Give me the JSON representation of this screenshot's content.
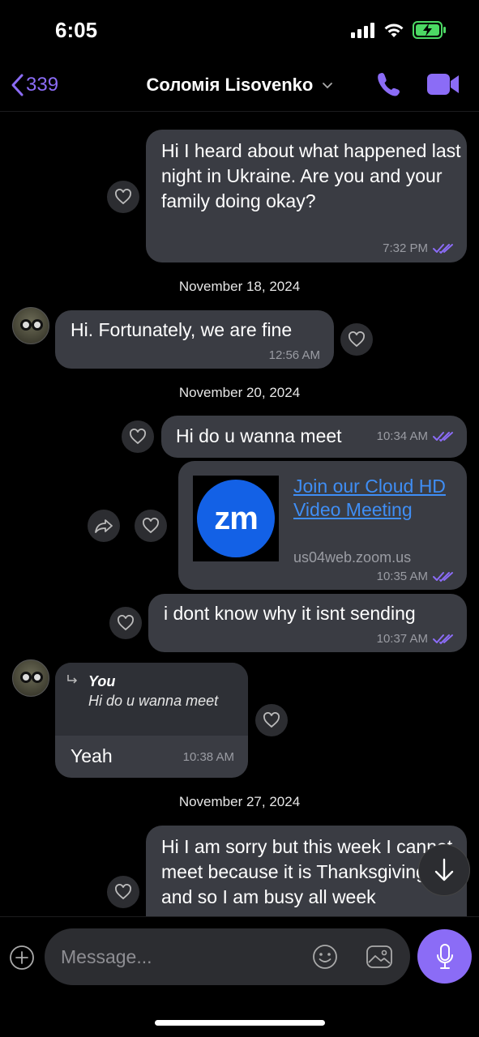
{
  "status": {
    "time": "6:05"
  },
  "header": {
    "back_count": "339",
    "contact_name": "Соломія Lisovenko"
  },
  "colors": {
    "accent": "#8b6cf6",
    "bubble": "#3a3c43",
    "link": "#3f8ef5"
  },
  "messages": {
    "m1": {
      "text": "Hi I heard about what happened last night in Ukraine. Are you and your family doing okay?",
      "time": "7:32 PM"
    },
    "date1": "November 18, 2024",
    "m2": {
      "text": "Hi. Fortunately, we are fine",
      "time": "12:56 AM"
    },
    "date2": "November 20, 2024",
    "m3": {
      "text": "Hi do u wanna meet",
      "time": "10:34 AM"
    },
    "m4": {
      "logo_text": "zm",
      "link_title": "Join our Cloud HD Video Meeting",
      "domain": "us04web.zoom.us",
      "time": "10:35 AM"
    },
    "m5": {
      "text": "i dont know why it isnt sending",
      "time": "10:37 AM"
    },
    "m6": {
      "reply_author": "You",
      "reply_text": "Hi do u wanna meet",
      "text": "Yeah",
      "time": "10:38 AM"
    },
    "date3": "November 27, 2024",
    "m7": {
      "text": "Hi I am sorry but this week I cannot meet because it is Thanksgiving and so I am busy all week"
    }
  },
  "composer": {
    "placeholder": "Message..."
  }
}
